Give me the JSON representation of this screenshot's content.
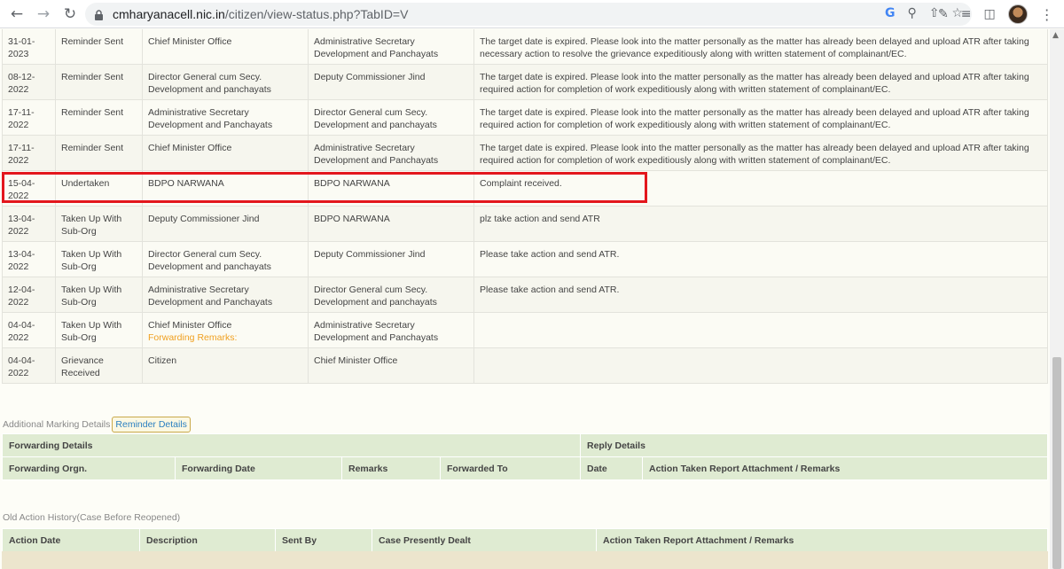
{
  "browser": {
    "url_host": "cmharyanacell.nic.in",
    "url_path": "/citizen/view-status.php?TabID=V"
  },
  "history_rows": [
    {
      "date": "31-01-2023",
      "status": "Reminder Sent",
      "from": "Chief Minister Office",
      "to": "Administrative Secretary Development and Panchayats",
      "remarks": "The target date is expired. Please look into the matter personally as the matter has already been delayed and upload ATR after taking necessary action to resolve the grievance expeditiously along with written statement of complainant/EC.",
      "note": ""
    },
    {
      "date": "08-12-2022",
      "status": "Reminder Sent",
      "from": "Director General cum Secy. Development and panchayats",
      "to": "Deputy Commissioner Jind",
      "remarks": "The target date is expired. Please look into the matter personally as the matter has already been delayed and upload ATR after taking required action for completion of work expeditiously along with written statement of complainant/EC.",
      "note": ""
    },
    {
      "date": "17-11-2022",
      "status": "Reminder Sent",
      "from": "Administrative Secretary Development and Panchayats",
      "to": "Director General cum Secy. Development and panchayats",
      "remarks": "The target date is expired. Please look into the matter personally as the matter has already been delayed and upload ATR after taking required action for completion of work expeditiously along with written statement of complainant/EC.",
      "note": ""
    },
    {
      "date": "17-11-2022",
      "status": "Reminder Sent",
      "from": "Chief Minister Office",
      "to": "Administrative Secretary Development and Panchayats",
      "remarks": "The target date is expired. Please look into the matter personally as the matter has already been delayed and upload ATR after taking required action for completion of work expeditiously along with written statement of complainant/EC.",
      "note": ""
    },
    {
      "date": "15-04-2022",
      "status": "Undertaken",
      "from": "BDPO NARWANA",
      "to": "BDPO NARWANA",
      "remarks": "Complaint received.",
      "note": ""
    },
    {
      "date": "13-04-2022",
      "status": "Taken Up With Sub-Org",
      "from": "Deputy Commissioner Jind",
      "to": "BDPO NARWANA",
      "remarks": "plz take action and send ATR",
      "note": ""
    },
    {
      "date": "13-04-2022",
      "status": "Taken Up With Sub-Org",
      "from": "Director General cum Secy. Development and panchayats",
      "to": "Deputy Commissioner Jind",
      "remarks": "Please take action and send ATR.",
      "note": ""
    },
    {
      "date": "12-04-2022",
      "status": "Taken Up With Sub-Org",
      "from": "Administrative Secretary Development and Panchayats",
      "to": "Director General cum Secy. Development and panchayats",
      "remarks": "Please take action and send ATR.",
      "note": ""
    },
    {
      "date": "04-04-2022",
      "status": "Taken Up With Sub-Org",
      "from": "Chief Minister Office",
      "to": "Administrative Secretary Development and Panchayats",
      "remarks": "",
      "note": "Forwarding Remarks:"
    },
    {
      "date": "04-04-2022",
      "status": "Grievance Received",
      "from": "Citizen",
      "to": "Chief Minister Office",
      "remarks": "",
      "note": ""
    }
  ],
  "tabs": {
    "additional": "Additional Marking Details",
    "reminder": "Reminder Details"
  },
  "forwarding": {
    "section_title": "Forwarding Details",
    "reply_title": "Reply Details",
    "col_orgn": "Forwarding Orgn.",
    "col_date": "Forwarding Date",
    "col_remarks": "Remarks",
    "col_forwarded_to": "Forwarded To",
    "col_reply_date": "Date",
    "col_atr": "Action Taken Report Attachment / Remarks"
  },
  "old_history": {
    "title": "Old Action History(Case Before Reopened)",
    "col_action_date": "Action Date",
    "col_description": "Description",
    "col_sent_by": "Sent By",
    "col_case_dealt": "Case Presently Dealt",
    "col_atr": "Action Taken Report Attachment / Remarks"
  },
  "colors": {
    "highlight": "#e3161d",
    "header_green": "#dfebd2",
    "note_orange": "#f0a020",
    "tab_link": "#2a7fc0"
  }
}
